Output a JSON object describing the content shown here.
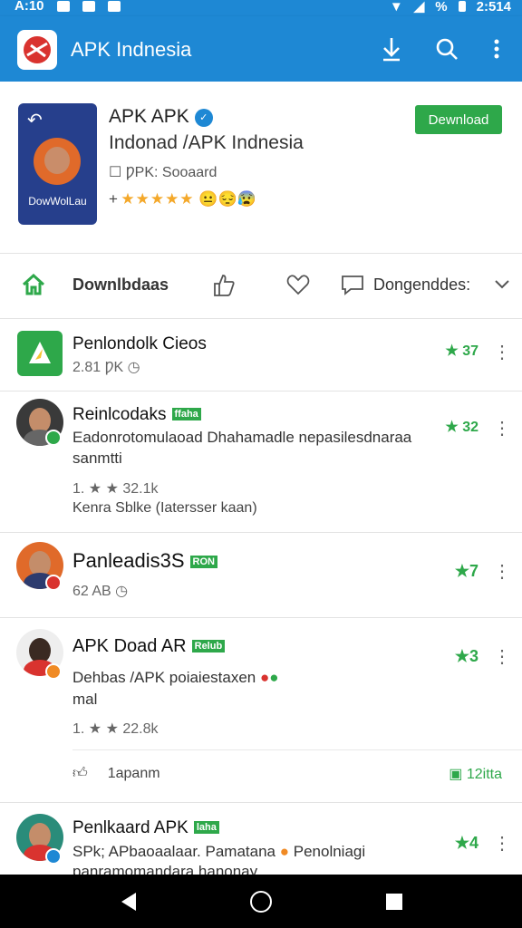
{
  "status_bar": {
    "time_left": "A:10",
    "battery": "%",
    "time_right": "2:514"
  },
  "app_bar": {
    "title": "APK Indnesia",
    "download_icon": "download-icon",
    "search_icon": "search-icon",
    "more_icon": "more-vert-icon"
  },
  "app": {
    "name": "APK APK",
    "subtitle": "Indonad /APK Indnesia",
    "developer": "☐ ǷPK: Sooaard",
    "rating_prefix": "+ ",
    "stars": "★★★★★",
    "icon_label": "DowWolLau",
    "download_label": "Dewnload"
  },
  "actions": {
    "home_icon": "home-icon",
    "downloads_label": "Downlbdaas",
    "like_icon": "thumbs-up-icon",
    "heart_icon": "heart-icon",
    "message_icon": "message-icon",
    "dropdown_label": "Dongenddes:",
    "chevron_icon": "chevron-down-icon"
  },
  "items": [
    {
      "title": "Penlondolk Cieos",
      "meta": "2.81    ǷK",
      "score": "★ 37"
    },
    {
      "title": "Reinlcodaks",
      "tag": "ffaha",
      "text": "Eadonrotomulaoad Dhahamadle nepasilesdnaraa sanmtti",
      "rating": "1. ★ ★ 32.1k",
      "sub": "Kenra Sblke (Iatersser kaan)",
      "score": "★ 32"
    },
    {
      "title": "Panleadis3S",
      "tag": "RON",
      "meta": "62    AB",
      "score": "★7"
    },
    {
      "title": "APK Doad AR",
      "tag": "Relub",
      "text": "Dehbas /APK poiaiestaxen",
      "text2": "mal",
      "rating": "1. ★ ★ 22.8k",
      "reply": "1apanm",
      "reply_count": "12itta",
      "score": "★3"
    },
    {
      "title": "Penlkaard APK",
      "tag": "laha",
      "text": "SPk; APbaoaalaar. Pamatana",
      "text_b": "Penolniagi",
      "text2": "panramomandara hanonay",
      "score": "★4"
    }
  ],
  "colors": {
    "primary": "#1e88d4",
    "accent": "#2ea84a",
    "star": "#f4a82a"
  }
}
